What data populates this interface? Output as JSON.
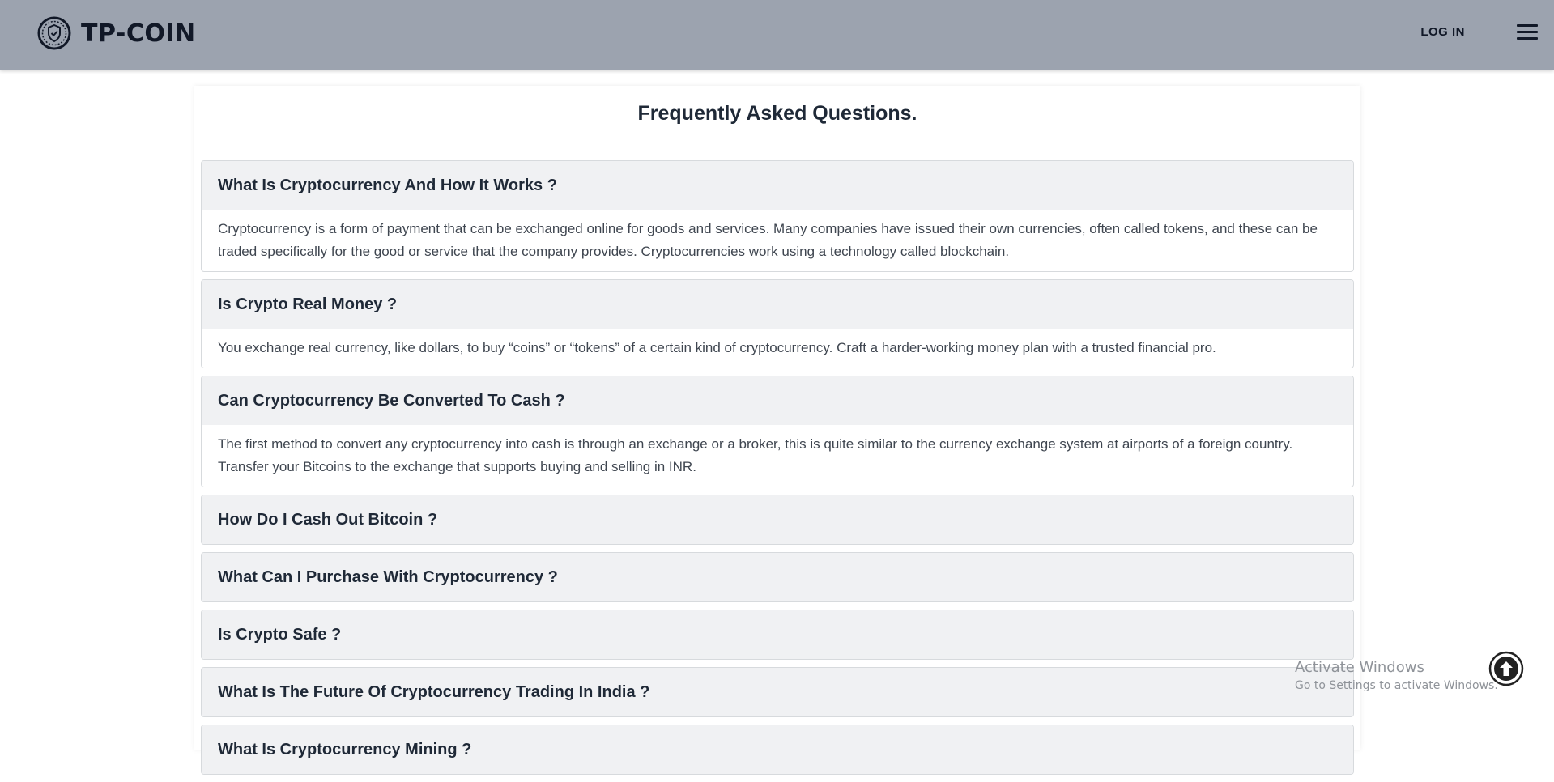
{
  "header": {
    "brand": "TP-COIN",
    "login_label": "LOG IN",
    "menu_icon": "hamburger-icon",
    "logo_icon": "shield-coin-icon"
  },
  "faq": {
    "title": "Frequently Asked Questions.",
    "items": [
      {
        "question": "What Is Cryptocurrency And How It Works ?",
        "answer": "Cryptocurrency is a form of payment that can be exchanged online for goods and services. Many companies have issued their own currencies, often called tokens, and these can be traded specifically for the good or service that the company provides. Cryptocurrencies work using a technology called blockchain."
      },
      {
        "question": "Is Crypto Real Money ?",
        "answer": "You exchange real currency, like dollars, to buy “coins” or “tokens” of a certain kind of cryptocurrency. Craft a harder-working money plan with a trusted financial pro."
      },
      {
        "question": "Can Cryptocurrency Be Converted To Cash ?",
        "answer": "The first method to convert any cryptocurrency into cash is through an exchange or a broker, this is quite similar to the currency exchange system at airports of a foreign country. Transfer your Bitcoins to the exchange that supports buying and selling in INR."
      },
      {
        "question": "How Do I Cash Out Bitcoin ?",
        "answer": ""
      },
      {
        "question": "What Can I Purchase With Cryptocurrency ?",
        "answer": ""
      },
      {
        "question": "Is Crypto Safe ?",
        "answer": ""
      },
      {
        "question": "What Is The Future Of Cryptocurrency Trading In India ?",
        "answer": ""
      },
      {
        "question": "What Is Cryptocurrency Mining ?",
        "answer": ""
      }
    ]
  },
  "watermark": {
    "line1": "Activate Windows",
    "line2": "Go to Settings to activate Windows."
  },
  "scroll_top_icon": "arrow-up-circle-icon",
  "colors": {
    "header_bg": "#9ca3af",
    "question_bg": "#f0f1f3",
    "text_dark": "#1f2937"
  }
}
